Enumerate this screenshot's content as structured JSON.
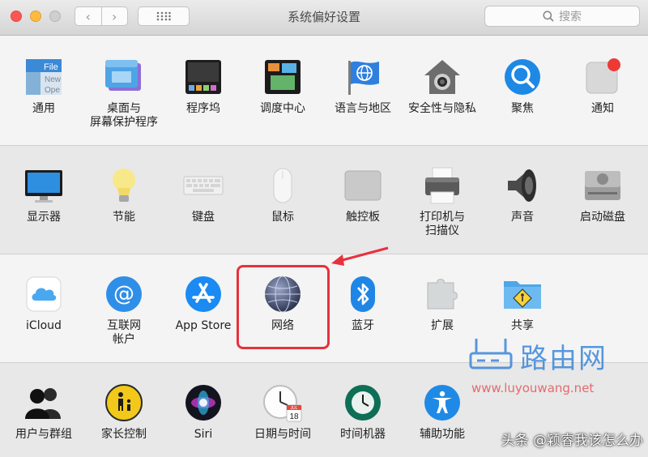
{
  "window": {
    "title": "系统偏好设置"
  },
  "toolbar": {
    "back": "‹",
    "forward": "›"
  },
  "search": {
    "placeholder": "搜索"
  },
  "rows": [
    [
      {
        "name": "general",
        "label": "通用",
        "icon": "general-icon"
      },
      {
        "name": "desktop-screensaver",
        "label": "桌面与\n屏幕保护程序",
        "icon": "desktop-icon"
      },
      {
        "name": "dock",
        "label": "程序坞",
        "icon": "dock-icon"
      },
      {
        "name": "mission-control",
        "label": "调度中心",
        "icon": "mission-control-icon"
      },
      {
        "name": "language-region",
        "label": "语言与地区",
        "icon": "flag-icon"
      },
      {
        "name": "security-privacy",
        "label": "安全性与隐私",
        "icon": "house-icon"
      },
      {
        "name": "spotlight",
        "label": "聚焦",
        "icon": "magnifier-icon"
      },
      {
        "name": "notifications",
        "label": "通知",
        "icon": "notification-icon"
      }
    ],
    [
      {
        "name": "displays",
        "label": "显示器",
        "icon": "monitor-icon"
      },
      {
        "name": "energy-saver",
        "label": "节能",
        "icon": "bulb-icon"
      },
      {
        "name": "keyboard",
        "label": "键盘",
        "icon": "keyboard-icon"
      },
      {
        "name": "mouse",
        "label": "鼠标",
        "icon": "mouse-icon"
      },
      {
        "name": "trackpad",
        "label": "触控板",
        "icon": "trackpad-icon"
      },
      {
        "name": "printers-scanners",
        "label": "打印机与\n扫描仪",
        "icon": "printer-icon"
      },
      {
        "name": "sound",
        "label": "声音",
        "icon": "speaker-icon"
      },
      {
        "name": "startup-disk",
        "label": "启动磁盘",
        "icon": "disk-icon"
      }
    ],
    [
      {
        "name": "icloud",
        "label": "iCloud",
        "icon": "cloud-icon"
      },
      {
        "name": "internet-accounts",
        "label": "互联网\n帐户",
        "icon": "at-icon"
      },
      {
        "name": "app-store",
        "label": "App Store",
        "icon": "app-store-icon"
      },
      {
        "name": "network",
        "label": "网络",
        "icon": "globe-icon"
      },
      {
        "name": "bluetooth",
        "label": "蓝牙",
        "icon": "bluetooth-icon"
      },
      {
        "name": "extensions",
        "label": "扩展",
        "icon": "puzzle-icon"
      },
      {
        "name": "sharing",
        "label": "共享",
        "icon": "folder-icon"
      }
    ],
    [
      {
        "name": "users-groups",
        "label": "用户与群组",
        "icon": "users-icon"
      },
      {
        "name": "parental-controls",
        "label": "家长控制",
        "icon": "parental-icon"
      },
      {
        "name": "siri",
        "label": "Siri",
        "icon": "siri-icon"
      },
      {
        "name": "date-time",
        "label": "日期与时间",
        "icon": "clock-icon"
      },
      {
        "name": "time-machine",
        "label": "时间机器",
        "icon": "time-machine-icon"
      },
      {
        "name": "accessibility",
        "label": "辅助功能",
        "icon": "accessibility-icon"
      }
    ]
  ],
  "icon_text": {
    "general": [
      "File",
      "New",
      "Ope"
    ],
    "calendar_month": "JUL",
    "calendar_day": "18"
  },
  "watermark": {
    "site_name": "路由网",
    "url": "www.luyouwang.net",
    "credit": "头条 @颖睿我该怎么办"
  },
  "colors": {
    "highlight": "#e8313e",
    "accent": "#2f80d8"
  }
}
